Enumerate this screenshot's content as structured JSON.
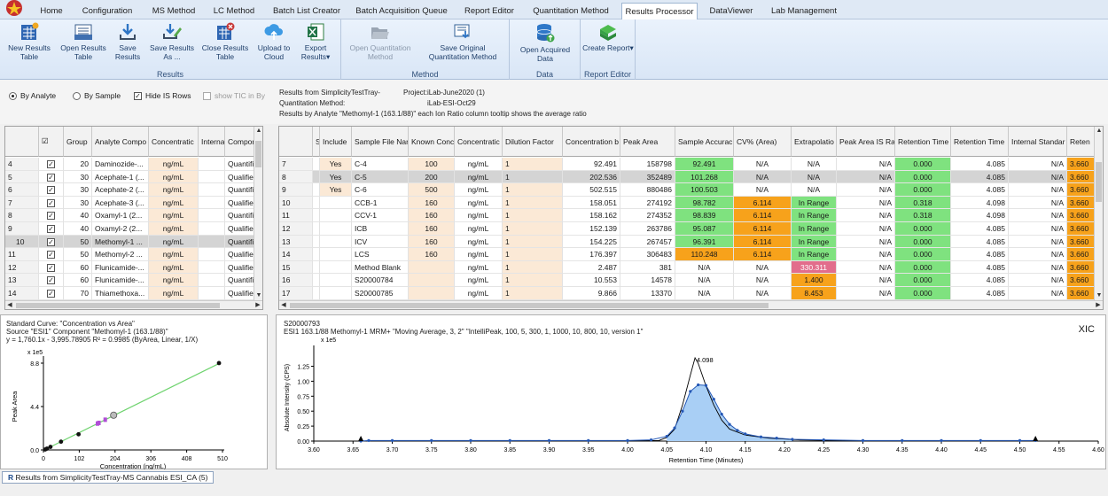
{
  "menu": {
    "tabs": [
      "Home",
      "Configuration",
      "MS Method",
      "LC Method",
      "Batch List Creator",
      "Batch Acquisition Queue",
      "Report Editor",
      "Quantitation Method",
      "Results Processor",
      "DataViewer",
      "Lab Management"
    ],
    "active": "Results Processor"
  },
  "ribbon": {
    "groups": [
      {
        "label": "Results",
        "buttons": [
          {
            "label": "New Results Table",
            "icon": "new-table-icon"
          },
          {
            "label": "Open Results Table",
            "icon": "open-table-icon"
          },
          {
            "label": "Save Results",
            "icon": "save-icon"
          },
          {
            "label": "Save Results As ...",
            "icon": "save-as-icon"
          },
          {
            "label": "Close Results Table",
            "icon": "close-table-icon"
          },
          {
            "label": "Upload to Cloud",
            "icon": "cloud-upload-icon"
          },
          {
            "label": "Export Results",
            "icon": "excel-export-icon"
          }
        ]
      },
      {
        "label": "Method",
        "buttons": [
          {
            "label": "Open Quantitation Method",
            "icon": "open-folder-icon",
            "disabled": true
          },
          {
            "label": "Save Original Quantitation Method",
            "icon": "save-method-icon"
          }
        ]
      },
      {
        "label": "Data",
        "buttons": [
          {
            "label": "Open Acquired Data",
            "icon": "database-icon"
          }
        ]
      },
      {
        "label": "Report Editor",
        "buttons": [
          {
            "label": "Create Report",
            "icon": "create-report-icon"
          }
        ]
      }
    ],
    "export_suffix": "▾",
    "create_suffix": "▾"
  },
  "options": {
    "by_analyte": "By Analyte",
    "by_sample": "By Sample",
    "hide_is": "Hide IS Rows",
    "show_tic": "show TIC in By"
  },
  "info": {
    "line1": "Results from SimplicityTestTray-",
    "project_label": "Project:",
    "project_value": "iLab-June2020 (1)",
    "quant_label": "Quantitation Method:",
    "quant_value": "iLab-ESI-Oct29",
    "line3": "Results by Analyte \"Methomyl-1 (163.1/88)\"   each Ion Ratio column tooltip shows the average ratio"
  },
  "left_table": {
    "headers": [
      "",
      "☑",
      "Group",
      "Analyte Compo",
      "Concentratic",
      "Interna",
      "Compor"
    ],
    "rows": [
      {
        "n": "4",
        "g": "20",
        "a": "Daminozide-...",
        "u": "ng/mL",
        "t": "Quantifi"
      },
      {
        "n": "5",
        "g": "30",
        "a": "Acephate-1 (...",
        "u": "ng/mL",
        "t": "Qualifier"
      },
      {
        "n": "6",
        "g": "30",
        "a": "Acephate-2 (...",
        "u": "ng/mL",
        "t": "Quantifi"
      },
      {
        "n": "7",
        "g": "30",
        "a": "Acephate-3 (...",
        "u": "ng/mL",
        "t": "Qualifier"
      },
      {
        "n": "8",
        "g": "40",
        "a": "Oxamyl-1 (2...",
        "u": "ng/mL",
        "t": "Quantifi"
      },
      {
        "n": "9",
        "g": "40",
        "a": "Oxamyl-2 (2...",
        "u": "ng/mL",
        "t": "Qualifier"
      },
      {
        "n": "10",
        "g": "50",
        "a": "Methomyl-1 ...",
        "u": "ng/mL",
        "t": "Quantifi",
        "selected": true
      },
      {
        "n": "11",
        "g": "50",
        "a": "Methomyl-2 ...",
        "u": "ng/mL",
        "t": "Qualifier"
      },
      {
        "n": "12",
        "g": "60",
        "a": "Flunicamide-...",
        "u": "ng/mL",
        "t": "Qualifier"
      },
      {
        "n": "13",
        "g": "60",
        "a": "Flunicamide-...",
        "u": "ng/mL",
        "t": "Quantifi"
      },
      {
        "n": "14",
        "g": "70",
        "a": "Thiamethoxa...",
        "u": "ng/mL",
        "t": "Qualifier"
      }
    ]
  },
  "right_table": {
    "headers": [
      "",
      "S",
      "Include",
      "Sample File Nan",
      "Known Conc",
      "Concentratic",
      "Dilution Factor",
      "Concentration b",
      "Peak Area",
      "Sample Accurac",
      "CV% (Area)",
      "Extrapolatio",
      "Peak Area IS Ra",
      "Retention Time",
      "Retention Time",
      "Internal Standar",
      "Reten"
    ],
    "rows": [
      {
        "n": "7",
        "inc": "Yes",
        "name": "C-4",
        "known": "100",
        "unit": "ng/mL",
        "dil": "1",
        "conc": "92.491",
        "area": "158798",
        "acc": "92.491",
        "cv": "N/A",
        "ext": "N/A",
        "isr": "N/A",
        "rt": "0.000",
        "rt2": "4.085",
        "is": "N/A",
        "ret": "3.660",
        "acc_c": "green",
        "cv_c": "",
        "ext_c": ""
      },
      {
        "n": "8",
        "inc": "Yes",
        "name": "C-5",
        "known": "200",
        "unit": "ng/mL",
        "dil": "1",
        "conc": "202.536",
        "area": "352489",
        "acc": "101.268",
        "cv": "N/A",
        "ext": "N/A",
        "isr": "N/A",
        "rt": "0.000",
        "rt2": "4.085",
        "is": "N/A",
        "ret": "3.660",
        "acc_c": "green",
        "cv_c": "",
        "ext_c": "",
        "selected": true
      },
      {
        "n": "9",
        "inc": "Yes",
        "name": "C-6",
        "known": "500",
        "unit": "ng/mL",
        "dil": "1",
        "conc": "502.515",
        "area": "880486",
        "acc": "100.503",
        "cv": "N/A",
        "ext": "N/A",
        "isr": "N/A",
        "rt": "0.000",
        "rt2": "4.085",
        "is": "N/A",
        "ret": "3.660",
        "acc_c": "green",
        "cv_c": "",
        "ext_c": ""
      },
      {
        "n": "10",
        "inc": "",
        "name": "CCB-1",
        "known": "160",
        "unit": "ng/mL",
        "dil": "1",
        "conc": "158.051",
        "area": "274192",
        "acc": "98.782",
        "cv": "6.114",
        "ext": "In Range",
        "isr": "N/A",
        "rt": "0.318",
        "rt2": "4.098",
        "is": "N/A",
        "ret": "3.660",
        "acc_c": "green",
        "cv_c": "orange",
        "ext_c": "green"
      },
      {
        "n": "11",
        "inc": "",
        "name": "CCV-1",
        "known": "160",
        "unit": "ng/mL",
        "dil": "1",
        "conc": "158.162",
        "area": "274352",
        "acc": "98.839",
        "cv": "6.114",
        "ext": "In Range",
        "isr": "N/A",
        "rt": "0.318",
        "rt2": "4.098",
        "is": "N/A",
        "ret": "3.660",
        "acc_c": "green",
        "cv_c": "orange",
        "ext_c": "green"
      },
      {
        "n": "12",
        "inc": "",
        "name": "ICB",
        "known": "160",
        "unit": "ng/mL",
        "dil": "1",
        "conc": "152.139",
        "area": "263786",
        "acc": "95.087",
        "cv": "6.114",
        "ext": "In Range",
        "isr": "N/A",
        "rt": "0.000",
        "rt2": "4.085",
        "is": "N/A",
        "ret": "3.660",
        "acc_c": "green",
        "cv_c": "orange",
        "ext_c": "green"
      },
      {
        "n": "13",
        "inc": "",
        "name": "ICV",
        "known": "160",
        "unit": "ng/mL",
        "dil": "1",
        "conc": "154.225",
        "area": "267457",
        "acc": "96.391",
        "cv": "6.114",
        "ext": "In Range",
        "isr": "N/A",
        "rt": "0.000",
        "rt2": "4.085",
        "is": "N/A",
        "ret": "3.660",
        "acc_c": "green",
        "cv_c": "orange",
        "ext_c": "green"
      },
      {
        "n": "14",
        "inc": "",
        "name": "LCS",
        "known": "160",
        "unit": "ng/mL",
        "dil": "1",
        "conc": "176.397",
        "area": "306483",
        "acc": "110.248",
        "cv": "6.114",
        "ext": "In Range",
        "isr": "N/A",
        "rt": "0.000",
        "rt2": "4.085",
        "is": "N/A",
        "ret": "3.660",
        "acc_c": "orange",
        "cv_c": "orange",
        "ext_c": "green"
      },
      {
        "n": "15",
        "inc": "",
        "name": "Method Blank",
        "known": "",
        "unit": "ng/mL",
        "dil": "1",
        "conc": "2.487",
        "area": "381",
        "acc": "N/A",
        "cv": "N/A",
        "ext": "330.311",
        "isr": "N/A",
        "rt": "0.000",
        "rt2": "4.085",
        "is": "N/A",
        "ret": "3.660",
        "acc_c": "",
        "cv_c": "",
        "ext_c": "pink"
      },
      {
        "n": "16",
        "inc": "",
        "name": "S20000784",
        "known": "",
        "unit": "ng/mL",
        "dil": "1",
        "conc": "10.553",
        "area": "14578",
        "acc": "N/A",
        "cv": "N/A",
        "ext": "1.400",
        "isr": "N/A",
        "rt": "0.000",
        "rt2": "4.085",
        "is": "N/A",
        "ret": "3.660",
        "acc_c": "",
        "cv_c": "",
        "ext_c": "orange"
      },
      {
        "n": "17",
        "inc": "",
        "name": "S20000785",
        "known": "",
        "unit": "ng/mL",
        "dil": "1",
        "conc": "9.866",
        "area": "13370",
        "acc": "N/A",
        "cv": "N/A",
        "ext": "8.453",
        "isr": "N/A",
        "rt": "0.000",
        "rt2": "4.085",
        "is": "N/A",
        "ret": "3.660",
        "acc_c": "",
        "cv_c": "",
        "ext_c": "orange"
      }
    ]
  },
  "colors": {
    "green": "#7fe27f",
    "orange": "#f7a21b",
    "pink": "#e26d8c",
    "beige": "#fbe9d6",
    "accent": "#2e6fc2"
  },
  "calibration": {
    "line1": "Standard Curve: \"Concentration vs Area\"",
    "line2": "Source \"ESI1\" Component \"Methomyl-1 (163.1/88)\"",
    "line3": "y = 1,760.1x - 3,995.78905    R² = 0.9985  (ByArea, Linear, 1/X)",
    "chart_data": {
      "type": "scatter",
      "xlabel": "Concentration (ng/mL)",
      "ylabel": "Peak Area",
      "y_multiplier": "x 1e5",
      "x_ticks": [
        "0",
        "102",
        "204",
        "306",
        "408",
        "510"
      ],
      "y_ticks": [
        "0.0",
        "4.4",
        "8.8"
      ],
      "xlim": [
        0,
        510
      ],
      "ylim": [
        0,
        880000
      ],
      "points": [
        {
          "x": 5,
          "y": 4800
        },
        {
          "x": 10,
          "y": 13500
        },
        {
          "x": 20,
          "y": 31000
        },
        {
          "x": 50,
          "y": 84000
        },
        {
          "x": 100,
          "y": 158798
        },
        {
          "x": 200,
          "y": 352489
        },
        {
          "x": 500,
          "y": 880486
        }
      ],
      "qc_points": [
        {
          "x": 158,
          "y": 274192
        },
        {
          "x": 154,
          "y": 267457
        },
        {
          "x": 176,
          "y": 306483
        }
      ],
      "fit": {
        "slope": 1760.1,
        "intercept": -3995.78905
      }
    }
  },
  "xic": {
    "sample": "S20000793",
    "line": "ESI1 163.1/88 Methomyl-1 MRM+ \"Moving Average, 3, 2\" \"IntelliPeak, 100, 5, 300, 1, 1000, 10, 800, 10, version 1\"",
    "y_multiplier": "x 1e5",
    "corner_label": "XIC",
    "peak_label": "4.098",
    "chart_data": {
      "type": "line",
      "xlabel": "Retention Time (Minutes)",
      "ylabel": "Absolute Intensity (CPS)",
      "xlim": [
        3.6,
        4.6
      ],
      "ylim": [
        0,
        1.45
      ],
      "x_ticks": [
        "3.60",
        "3.65",
        "3.70",
        "3.75",
        "3.80",
        "3.85",
        "3.90",
        "3.95",
        "4.00",
        "4.05",
        "4.10",
        "4.15",
        "4.20",
        "4.25",
        "4.30",
        "4.35",
        "4.40",
        "4.45",
        "4.50",
        "4.55",
        "4.60"
      ],
      "y_ticks": [
        "0.00",
        "0.25",
        "0.50",
        "0.75",
        "1.00",
        "1.25"
      ],
      "raw": [
        [
          3.66,
          0.0
        ],
        [
          4.04,
          0.01
        ],
        [
          4.05,
          0.06
        ],
        [
          4.06,
          0.2
        ],
        [
          4.07,
          0.6
        ],
        [
          4.08,
          1.1
        ],
        [
          4.086,
          1.39
        ],
        [
          4.09,
          1.3
        ],
        [
          4.1,
          0.92
        ],
        [
          4.11,
          0.6
        ],
        [
          4.12,
          0.35
        ],
        [
          4.13,
          0.2
        ],
        [
          4.15,
          0.1
        ],
        [
          4.18,
          0.05
        ],
        [
          4.22,
          0.02
        ],
        [
          4.3,
          0.005
        ],
        [
          4.52,
          0.0
        ]
      ],
      "smoothed": [
        [
          3.66,
          0.0
        ],
        [
          3.67,
          0.01
        ],
        [
          3.7,
          0.01
        ],
        [
          3.75,
          0.01
        ],
        [
          3.8,
          0.01
        ],
        [
          3.85,
          0.01
        ],
        [
          3.9,
          0.01
        ],
        [
          3.95,
          0.01
        ],
        [
          4.0,
          0.01
        ],
        [
          4.03,
          0.02
        ],
        [
          4.05,
          0.08
        ],
        [
          4.06,
          0.22
        ],
        [
          4.07,
          0.5
        ],
        [
          4.08,
          0.83
        ],
        [
          4.09,
          0.94
        ],
        [
          4.1,
          0.93
        ],
        [
          4.11,
          0.7
        ],
        [
          4.12,
          0.45
        ],
        [
          4.13,
          0.28
        ],
        [
          4.14,
          0.18
        ],
        [
          4.15,
          0.12
        ],
        [
          4.17,
          0.07
        ],
        [
          4.19,
          0.05
        ],
        [
          4.21,
          0.03
        ],
        [
          4.25,
          0.02
        ],
        [
          4.3,
          0.01
        ],
        [
          4.35,
          0.01
        ],
        [
          4.4,
          0.01
        ],
        [
          4.45,
          0.01
        ],
        [
          4.5,
          0.01
        ],
        [
          4.52,
          0.01
        ]
      ]
    }
  },
  "status": {
    "doc_tab": "Results from SimplicityTestTray-MS Cannabis ESI_CA (5)",
    "r_icon": "R"
  }
}
